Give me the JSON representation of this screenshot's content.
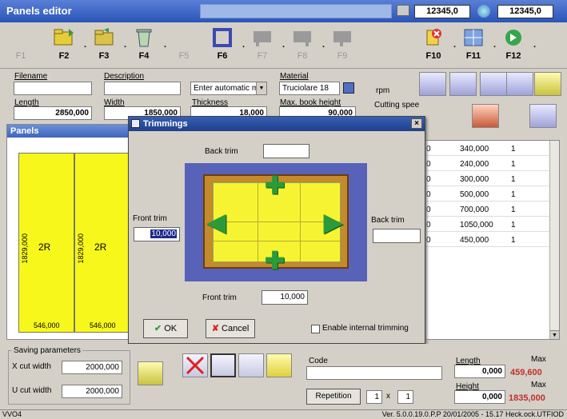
{
  "window": {
    "title": "Panels editor",
    "value_left": "12345,0",
    "value_right": "12345,0"
  },
  "toolbar": {
    "buttons": [
      {
        "key": "F1",
        "icon": "blank-icon",
        "enabled": false
      },
      {
        "key": "F2",
        "icon": "open-folder-icon",
        "enabled": true
      },
      {
        "key": "F3",
        "icon": "folder-icon",
        "enabled": true
      },
      {
        "key": "F4",
        "icon": "recycle-bin-icon",
        "enabled": true
      },
      {
        "key": "F5",
        "icon": "blank-icon",
        "enabled": false
      },
      {
        "key": "F6",
        "icon": "frame-icon",
        "enabled": true
      },
      {
        "key": "F7",
        "icon": "machine-icon",
        "enabled": false
      },
      {
        "key": "F8",
        "icon": "machine-icon",
        "enabled": false
      },
      {
        "key": "F9",
        "icon": "machine-icon",
        "enabled": false
      },
      {
        "key": "F10",
        "icon": "exit-icon",
        "enabled": true
      },
      {
        "key": "F11",
        "icon": "grid-icon",
        "enabled": true
      },
      {
        "key": "F12",
        "icon": "go-icon",
        "enabled": true
      }
    ]
  },
  "form": {
    "filename_label": "Filename",
    "filename_value": "",
    "description_label": "Description",
    "description_value": "",
    "automatic_select": "Enter automatic m",
    "material_label": "Material",
    "material_value": "Truciolare 18",
    "length_label": "Length",
    "length_value": "2850,000",
    "width_label": "Width",
    "width_value": "1850,000",
    "thickness_label": "Thickness",
    "thickness_value": "18,000",
    "max_book_height_label": "Max. book height",
    "max_book_height_value": "90,000",
    "rpm_label": "rpm",
    "cutting_speed_label": "Cutting spee"
  },
  "panels_window": {
    "title": "Panels",
    "strips": [
      {
        "label": "2R",
        "vertical_value": "1829,000",
        "bottom_value": "546,000"
      },
      {
        "label": "2R",
        "vertical_value": "1829,000",
        "bottom_value": "546,000"
      }
    ]
  },
  "table": {
    "rows": [
      {
        "c0": "0",
        "c1": "340,000",
        "c2": "1"
      },
      {
        "c0": "0",
        "c1": "240,000",
        "c2": "1"
      },
      {
        "c0": "0",
        "c1": "300,000",
        "c2": "1"
      },
      {
        "c0": "0",
        "c1": "500,000",
        "c2": "1"
      },
      {
        "c0": "0",
        "c1": "700,000",
        "c2": "1"
      },
      {
        "c0": "0",
        "c1": "1050,000",
        "c2": "1"
      },
      {
        "c0": "0",
        "c1": "450,000",
        "c2": "1"
      }
    ]
  },
  "dialog": {
    "title": "Trimmings",
    "close": "×",
    "back_trim_top_label": "Back trim",
    "back_trim_top_value": "",
    "front_trim_left_label": "Front trim",
    "front_trim_left_value": "10,000",
    "back_trim_right_label": "Back trim",
    "back_trim_right_value": "",
    "front_trim_bottom_label": "Front trim",
    "front_trim_bottom_value": "10,000",
    "ok_label": "OK",
    "cancel_label": "Cancel",
    "enable_internal_label": "Enable internal trimming",
    "enable_internal_checked": false
  },
  "bottom": {
    "saving_parameters_label": "Saving parameters",
    "x_cut_width_label": "X cut width",
    "x_cut_width_value": "2000,000",
    "u_cut_width_label": "U cut width",
    "u_cut_width_value": "2000,000",
    "code_label": "Code",
    "code_value": "",
    "repetition_label": "Repetition",
    "repetition_a": "1",
    "repetition_x": "x",
    "repetition_b": "1",
    "length_label": "Length",
    "length_value": "0,000",
    "length_max_label": "Max",
    "length_max_value": "459,600",
    "height_label": "Height",
    "height_value": "0,000",
    "height_max_label": "Max",
    "height_max_value": "1835,000"
  },
  "statusbar": {
    "left": "VVO4",
    "right": "Ver. 5.0.0.19.0.P.P   20/01/2005 - 15.17   Heck.ock.UTFIOD"
  },
  "colors": {
    "title_blue": "#2a55b8",
    "panel_yellow": "#f7f71c",
    "trim_arrow_green": "#2d9a3a",
    "max_red": "#c0302a"
  }
}
